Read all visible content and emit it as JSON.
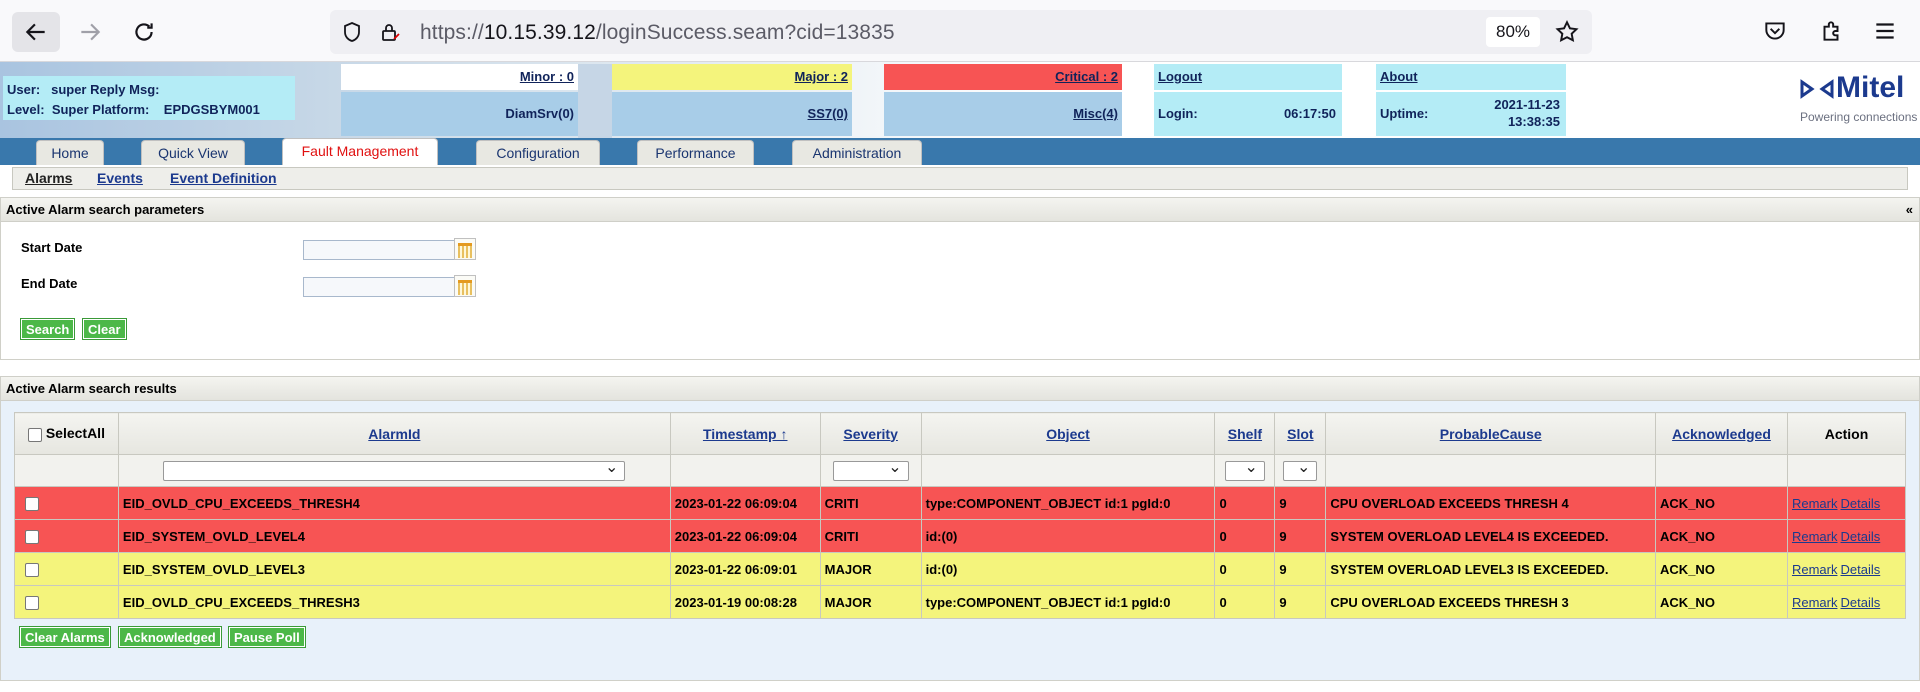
{
  "browser": {
    "url_prefix": "https://",
    "url_host": "10.15.39.12",
    "url_path": "/loginSuccess.seam?cid=13835",
    "zoom": "80%"
  },
  "header": {
    "user_label": "User:",
    "user_value": "super",
    "reply_label": "Reply Msg:",
    "level_label": "Level:",
    "level_value": "Super",
    "platform_label": "Platform:",
    "platform_value": "EPDGSBYM001",
    "minor": "Minor : 0",
    "major": "Major : 2",
    "critical": "Critical : 2",
    "logout": "Logout",
    "about": "About",
    "diamsrv": "DiamSrv(0)",
    "ss7": "SS7(0)",
    "misc": "Misc(4)",
    "login_label": "Login:",
    "login_value": "06:17:50",
    "uptime_label": "Uptime:",
    "uptime_date": "2021-11-23",
    "uptime_time": "13:38:35",
    "brand": "Mitel",
    "tagline": "Powering connections",
    "colors": {
      "minor": "#ffffff",
      "major": "#f4f47c",
      "critical": "#f75454",
      "info": "#b4ecf6"
    }
  },
  "tabs": [
    "Home",
    "Quick View",
    "Fault Management",
    "Configuration",
    "Performance",
    "Administration"
  ],
  "submenu": [
    "Alarms",
    "Events",
    "Event Definition"
  ],
  "search": {
    "title": "Active Alarm search parameters",
    "collapse": "«",
    "start_label": "Start Date",
    "end_label": "End Date",
    "search_btn": "Search",
    "clear_btn": "Clear"
  },
  "results": {
    "title": "Active Alarm search results",
    "columns": [
      "SelectAll",
      "AlarmId",
      "Timestamp ↑",
      "Severity",
      "Object",
      "Shelf",
      "Slot",
      "ProbableCause",
      "Acknowledged",
      "Action"
    ],
    "rows": [
      {
        "alarm": "EID_OVLD_CPU_EXCEEDS_THRESH4",
        "ts": "2023-01-22 06:09:04",
        "sev": "CRITI",
        "obj": "type:COMPONENT_OBJECT id:1 pgId:0",
        "shelf": "0",
        "slot": "9",
        "cause": "CPU OVERLOAD EXCEEDS THRESH 4",
        "ack": "ACK_NO",
        "remark": "Remark",
        "details": "Details"
      },
      {
        "alarm": "EID_SYSTEM_OVLD_LEVEL4",
        "ts": "2023-01-22 06:09:04",
        "sev": "CRITI",
        "obj": "id:(0)",
        "shelf": "0",
        "slot": "9",
        "cause": "SYSTEM OVERLOAD LEVEL4 IS EXCEEDED.",
        "ack": "ACK_NO",
        "remark": "Remark",
        "details": "Details"
      },
      {
        "alarm": "EID_SYSTEM_OVLD_LEVEL3",
        "ts": "2023-01-22 06:09:01",
        "sev": "MAJOR",
        "obj": "id:(0)",
        "shelf": "0",
        "slot": "9",
        "cause": "SYSTEM OVERLOAD LEVEL3 IS EXCEEDED.",
        "ack": "ACK_NO",
        "remark": "Remark",
        "details": "Details"
      },
      {
        "alarm": "EID_OVLD_CPU_EXCEEDS_THRESH3",
        "ts": "2023-01-19 00:08:28",
        "sev": "MAJOR",
        "obj": "type:COMPONENT_OBJECT id:1 pgId:0",
        "shelf": "0",
        "slot": "9",
        "cause": "CPU OVERLOAD EXCEEDS THRESH 3",
        "ack": "ACK_NO",
        "remark": "Remark",
        "details": "Details"
      }
    ],
    "buttons": [
      "Clear Alarms",
      "Acknowledged",
      "Pause Poll"
    ]
  }
}
